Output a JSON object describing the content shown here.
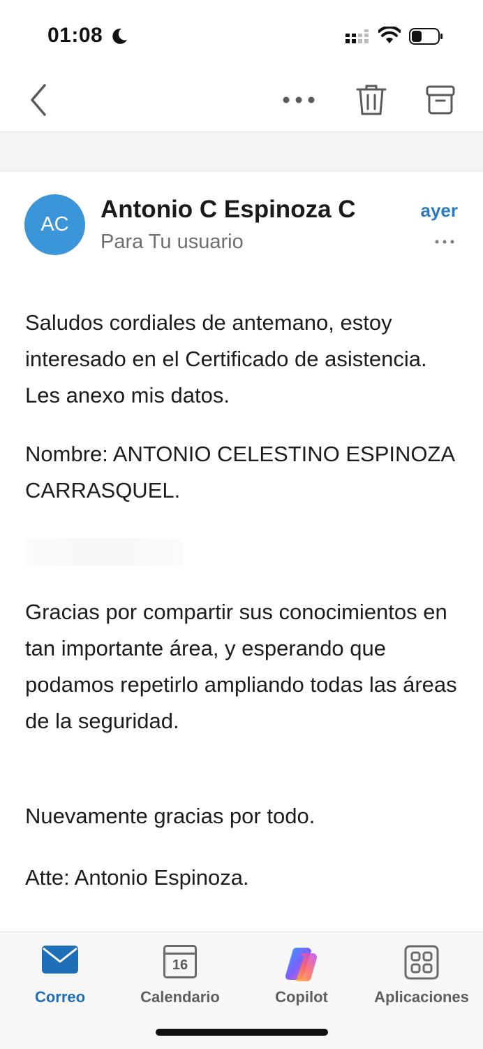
{
  "status_bar": {
    "time": "01:08"
  },
  "toolbar": {
    "icons": [
      "back-chevron-icon",
      "more-horizontal-icon",
      "trash-icon",
      "archive-icon"
    ]
  },
  "message": {
    "avatar_initials": "AC",
    "avatar_color": "#3a95d9",
    "sender": "Antonio C Espinoza C",
    "recipient": "Para Tu usuario",
    "date": "ayer",
    "paragraphs": [
      "Saludos cordiales de antemano, estoy interesado en el Certificado de asistencia.  Les anexo mis datos.",
      "Nombre: ANTONIO CELESTINO ESPINOZA CARRASQUEL.",
      "Gracias por compartir sus conocimientos en tan importante área, y esperando que podamos repetirlo ampliando todas las áreas de la seguridad.",
      "Nuevamente gracias por todo.",
      "Atte: Antonio Espinoza."
    ]
  },
  "tabbar": {
    "tabs": [
      {
        "label": "Correo",
        "icon": "mail-icon",
        "active": true
      },
      {
        "label": "Calendario",
        "icon": "calendar-icon",
        "date_number": "16"
      },
      {
        "label": "Copilot",
        "icon": "copilot-icon"
      },
      {
        "label": "Aplicaciones",
        "icon": "apps-grid-icon"
      }
    ]
  },
  "colors": {
    "accent": "#1f6fb8",
    "date": "#2a7bc4"
  }
}
